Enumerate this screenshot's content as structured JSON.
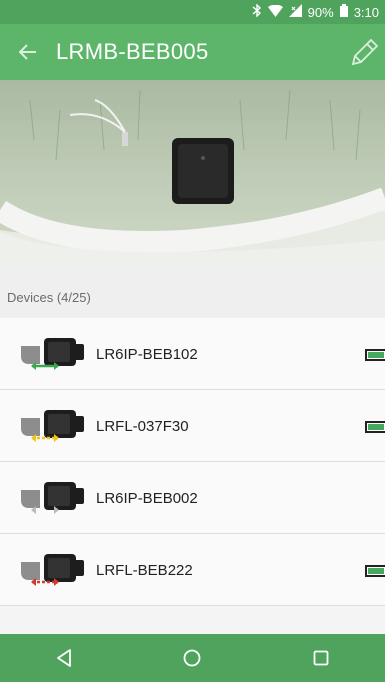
{
  "status_bar": {
    "battery": "90%",
    "time": "3:10",
    "icons": [
      "bluetooth-icon",
      "wifi-icon",
      "signal-icon",
      "battery-icon"
    ]
  },
  "app_bar": {
    "title": "LRMB-BEB005",
    "back_icon": "arrow-left-icon",
    "edit_icon": "pencil-icon"
  },
  "devices_header": "Devices (4/25)",
  "devices": [
    {
      "name": "LR6IP-BEB102",
      "link": "good",
      "link_color": "#3aa84f",
      "battery": true
    },
    {
      "name": "LRFL-037F30",
      "link": "weak",
      "link_color": "#f0c419",
      "battery": true
    },
    {
      "name": "LR6IP-BEB002",
      "link": "none",
      "link_color": "#b9b9b9",
      "battery": false
    },
    {
      "name": "LRFL-BEB222",
      "link": "bad",
      "link_color": "#d23b2e",
      "battery": true
    }
  ],
  "nav": {
    "icons": [
      "back-triangle-icon",
      "home-circle-icon",
      "recents-square-icon"
    ]
  },
  "colors": {
    "primary": "#5db56a",
    "primary_dark": "#4fa35c",
    "battery_fill": "#46a85a"
  }
}
